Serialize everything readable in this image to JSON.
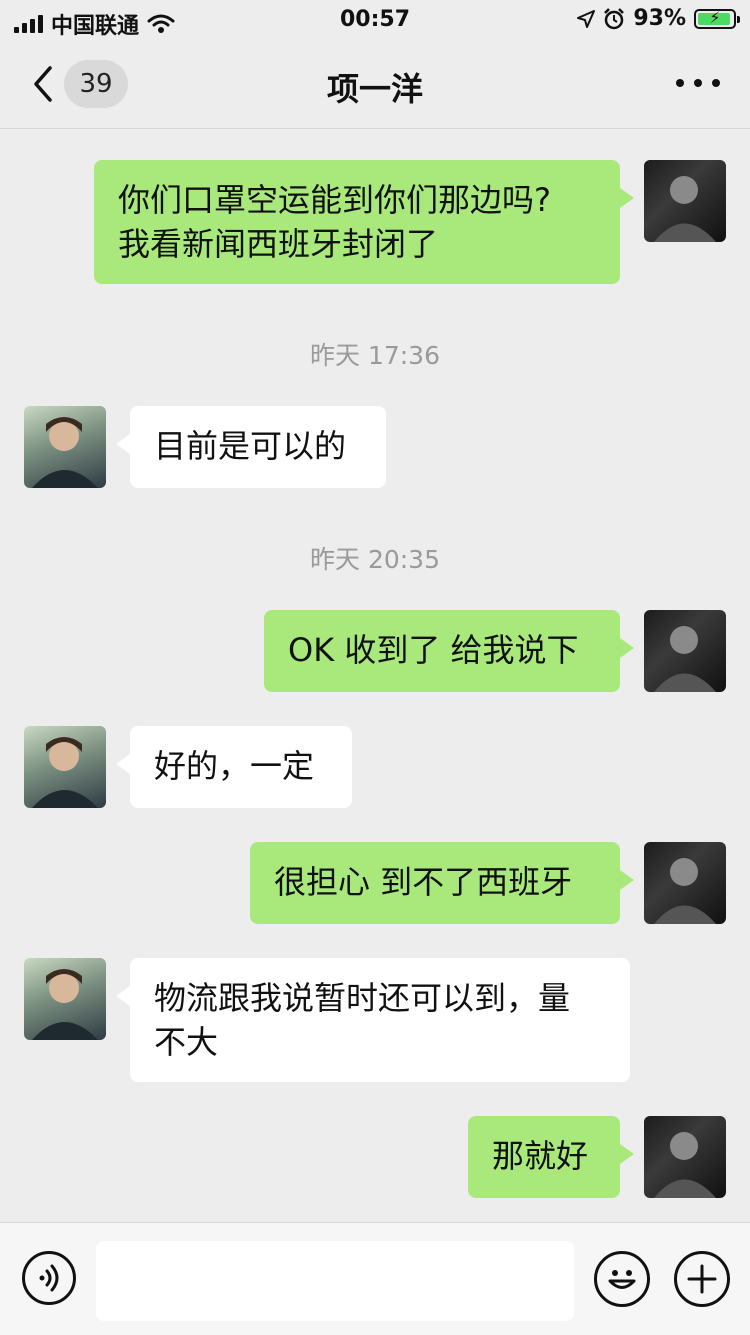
{
  "status_bar": {
    "carrier": "中国联通",
    "time": "00:57",
    "battery_percent": "93%",
    "battery_level": 0.93,
    "icons": [
      "signal-icon",
      "wifi-icon",
      "location-icon",
      "alarm-icon",
      "battery-icon"
    ]
  },
  "nav": {
    "title": "项一洋",
    "unread_count": "39"
  },
  "messages": [
    {
      "from": "self",
      "lines": [
        "你们口罩空运能到你们那边吗?",
        "我看新闻西班牙封闭了"
      ]
    },
    {
      "timestamp": "昨天 17:36"
    },
    {
      "from": "other",
      "text": "目前是可以的"
    },
    {
      "timestamp": "昨天 20:35"
    },
    {
      "from": "self",
      "text": "OK 收到了 给我说下"
    },
    {
      "from": "other",
      "text": "好的，一定"
    },
    {
      "from": "self",
      "text": "很担心 到不了西班牙"
    },
    {
      "from": "other",
      "lines": [
        "物流跟我说暂时还可以到，量",
        "不大"
      ]
    },
    {
      "from": "self",
      "text": "那就好"
    }
  ],
  "input_bar": {
    "placeholder": "",
    "icons": [
      "voice-icon",
      "emoji-icon",
      "plus-icon"
    ]
  },
  "colors": {
    "outgoing_bubble": "#a9e97c",
    "incoming_bubble": "#ffffff",
    "background": "#ededed"
  }
}
